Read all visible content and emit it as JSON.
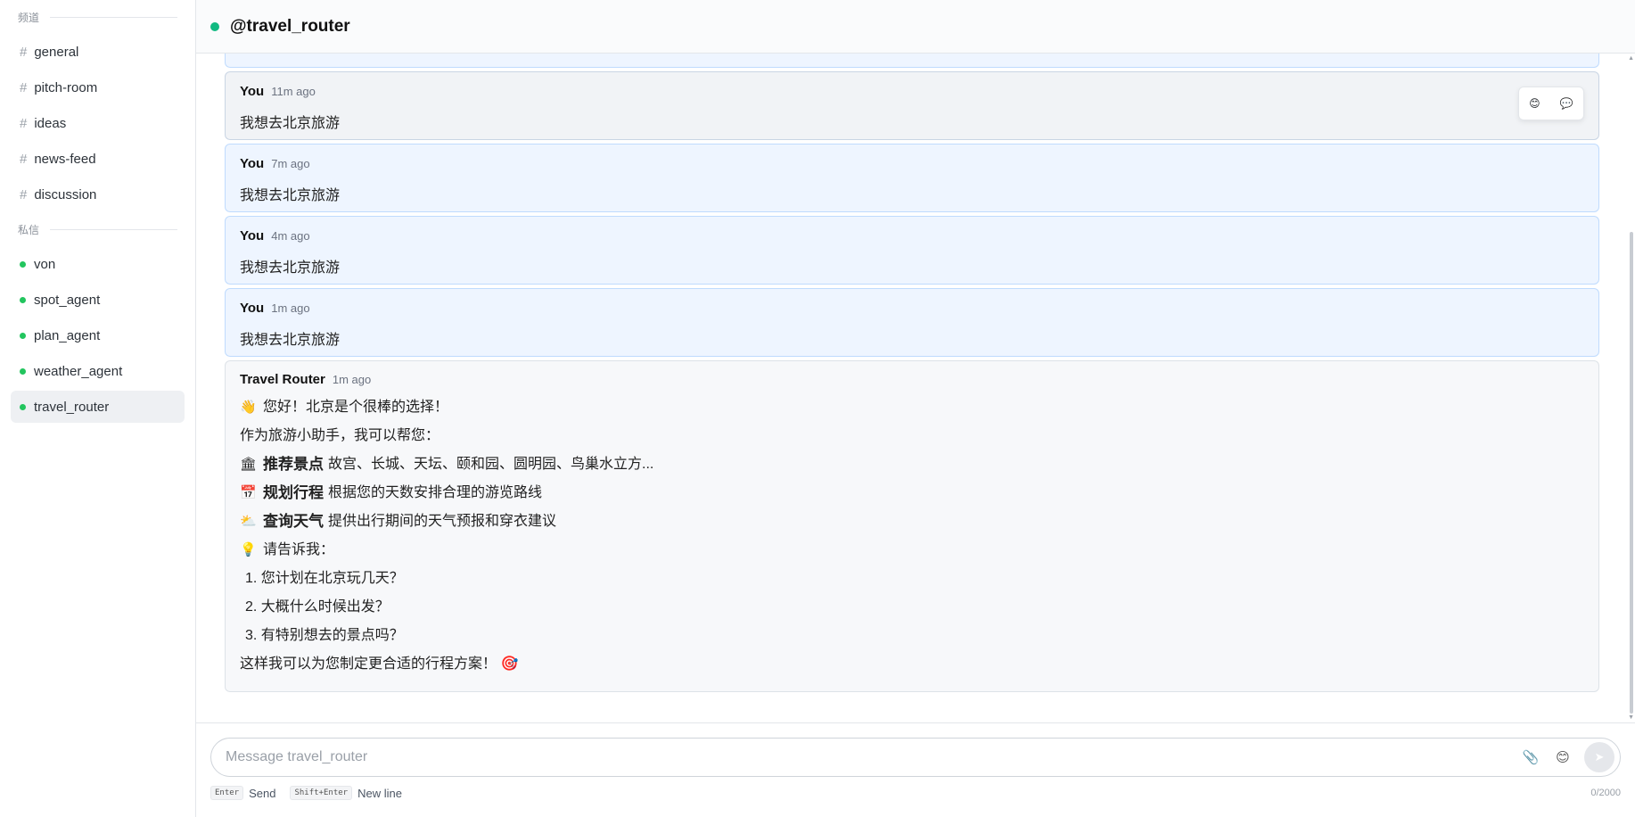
{
  "sidebar": {
    "channels_header": "频道",
    "channels": [
      {
        "label": "general"
      },
      {
        "label": "pitch-room"
      },
      {
        "label": "ideas"
      },
      {
        "label": "news-feed"
      },
      {
        "label": "discussion"
      }
    ],
    "dm_header": "私信",
    "dms": [
      {
        "label": "von"
      },
      {
        "label": "spot_agent"
      },
      {
        "label": "plan_agent"
      },
      {
        "label": "weather_agent"
      },
      {
        "label": "travel_router",
        "active": true
      }
    ],
    "hash_symbol": "#"
  },
  "header": {
    "title": "@travel_router",
    "status_color": "#10b981"
  },
  "messages": [
    {
      "author": "You",
      "time": "11m ago",
      "text": "我想去北京旅游"
    },
    {
      "author": "You",
      "time": "7m ago",
      "text": "我想去北京旅游"
    },
    {
      "author": "You",
      "time": "4m ago",
      "text": "我想去北京旅游"
    },
    {
      "author": "You",
      "time": "1m ago",
      "text": "我想去北京旅游"
    }
  ],
  "bot_message": {
    "author": "Travel Router",
    "time": "1m ago",
    "lines": [
      {
        "emoji": "👋",
        "bold": "",
        "text": "您好！北京是个很棒的选择！"
      },
      {
        "emoji": "",
        "bold": "",
        "text": "作为旅游小助手，我可以帮您："
      },
      {
        "emoji": "🏛",
        "bold": "推荐景点",
        "text": "故宫、长城、天坛、颐和园、圆明园、鸟巢水立方..."
      },
      {
        "emoji": "📅",
        "bold": "规划行程",
        "text": "根据您的天数安排合理的游览路线"
      },
      {
        "emoji": "⛅",
        "bold": "查询天气",
        "text": "提供出行期间的天气预报和穿衣建议"
      },
      {
        "emoji": "💡",
        "bold": "",
        "text": "请告诉我："
      },
      {
        "emoji": "",
        "bold": "",
        "text": "1. 您计划在北京玩几天？"
      },
      {
        "emoji": "",
        "bold": "",
        "text": "2. 大概什么时候出发？"
      },
      {
        "emoji": "",
        "bold": "",
        "text": "3. 有特别想去的景点吗？"
      },
      {
        "emoji": "",
        "bold": "",
        "text": "这样我可以为您制定更合适的行程方案！ 🎯"
      }
    ]
  },
  "hover_actions": {
    "react_icon": "😊",
    "reply_icon": "💬"
  },
  "composer": {
    "placeholder": "Message travel_router",
    "attach_icon": "📎",
    "emoji_icon": "😊",
    "send_icon": "➤",
    "enter_key": "Enter",
    "enter_hint": "Send",
    "shift_enter_key": "Shift+Enter",
    "shift_enter_hint": "New line",
    "counter": "0/2000"
  }
}
